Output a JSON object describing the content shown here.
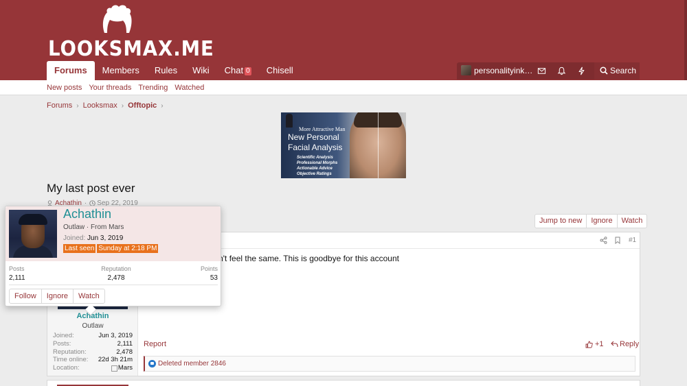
{
  "site": {
    "logo_text": "LOOKSMAX.ME"
  },
  "nav": {
    "tabs": [
      {
        "label": "Forums",
        "active": true
      },
      {
        "label": "Members"
      },
      {
        "label": "Rules"
      },
      {
        "label": "Wiki"
      },
      {
        "label": "Chat",
        "badge": "0"
      },
      {
        "label": "Chisell"
      }
    ]
  },
  "account": {
    "username": "personalityink…",
    "icons": [
      "envelope-icon",
      "bell-icon",
      "bolt-icon"
    ],
    "search_label": "Search"
  },
  "subnav": {
    "links": [
      "New posts",
      "Your threads",
      "Trending",
      "Watched"
    ]
  },
  "breadcrumb": [
    "Forums",
    "Looksmax",
    "Offtopic"
  ],
  "banner": {
    "small_text": "More Attractive Man",
    "title_line1": "New Personal",
    "title_line2": "Facial Analysis",
    "features": [
      "Scientific Analysis",
      "Professional Morphs",
      "Actionable Advice",
      "Objective Ratings"
    ]
  },
  "thread": {
    "title": "My last post ever",
    "author": "Achathin",
    "date": "Sep 22, 2019",
    "buttons": [
      "Jump to new",
      "Ignore",
      "Watch"
    ]
  },
  "post": {
    "number": "#1",
    "body_visible": "een revealed it doesn't feel the same. This is goodbye for this account",
    "report_label": "Report",
    "like_label": "+1",
    "reply_label": "Reply",
    "reactions_text": "Deleted member 2846",
    "user": {
      "name": "Achathin",
      "title": "Outlaw",
      "stats": [
        {
          "k": "Joined:",
          "v": "Jun 3, 2019"
        },
        {
          "k": "Posts:",
          "v": "2,111"
        },
        {
          "k": "Reputation:",
          "v": "2,478"
        },
        {
          "k": "Time online:",
          "v": "22d 3h 21m"
        },
        {
          "k": "Location:",
          "v": "Mars"
        }
      ]
    }
  },
  "tooltip": {
    "name": "Achathin",
    "title_from": "Outlaw · From Mars",
    "joined_label": "Joined:",
    "joined_value": "Jun 3, 2019",
    "last_seen_label": "Last seen",
    "last_seen_value": "Sunday at 2:18 PM",
    "stats": [
      {
        "k": "Posts",
        "v": "2,111"
      },
      {
        "k": "Reputation",
        "v": "2,478"
      },
      {
        "k": "Points",
        "v": "53"
      }
    ],
    "buttons": [
      "Follow",
      "Ignore",
      "Watch"
    ]
  },
  "colors": {
    "header": "#963538",
    "accent_link": "#963538",
    "username": "#1f8f94",
    "last_seen_chip": "#e8711c"
  }
}
